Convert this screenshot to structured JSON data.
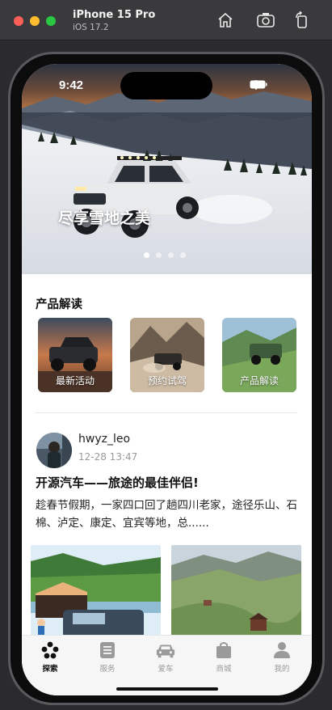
{
  "simulator": {
    "device_name": "iPhone 15 Pro",
    "os_version": "iOS 17.2",
    "buttons": [
      "home-icon",
      "screenshot-icon",
      "rotate-icon"
    ]
  },
  "status_bar": {
    "time": "9:42"
  },
  "hero": {
    "caption": "尽享雪地之美",
    "slide_count": 4,
    "active_slide": 1
  },
  "products": {
    "title": "产品解读",
    "cards": [
      {
        "label": "最新活动"
      },
      {
        "label": "预约试驾"
      },
      {
        "label": "产品解读"
      }
    ]
  },
  "post": {
    "username": "hwyz_leo",
    "time": "12-28 13:47",
    "title": "开源汽车——旅途的最佳伴侣!",
    "body": "趁春节假期，一家四口回了趟四川老家，途径乐山、石棉、泸定、康定、宜宾等地，总......"
  },
  "tabbar": {
    "items": [
      {
        "label": "探索",
        "icon": "explore-icon",
        "active": true
      },
      {
        "label": "服务",
        "icon": "service-icon",
        "active": false
      },
      {
        "label": "爱车",
        "icon": "car-icon",
        "active": false
      },
      {
        "label": "商城",
        "icon": "shop-icon",
        "active": false
      },
      {
        "label": "我的",
        "icon": "profile-icon",
        "active": false
      }
    ]
  },
  "colors": {
    "active_tab": "#111111",
    "inactive_tab": "#9a9a9a",
    "tabbar_bg": "#f6f6f6"
  }
}
